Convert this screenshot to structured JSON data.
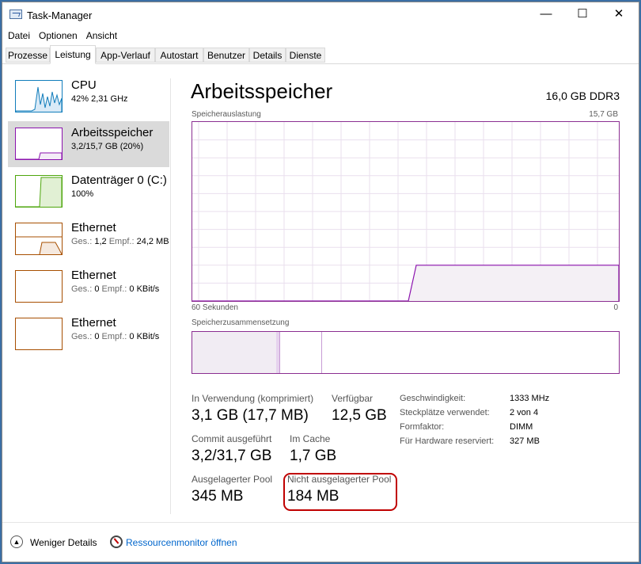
{
  "window": {
    "title": "Task-Manager",
    "minimize_glyph": "—",
    "maximize_glyph": "☐",
    "close_glyph": "✕"
  },
  "menu": {
    "items": [
      "Datei",
      "Optionen",
      "Ansicht"
    ]
  },
  "tabs": [
    "Prozesse",
    "Leistung",
    "App-Verlauf",
    "Autostart",
    "Benutzer",
    "Details",
    "Dienste"
  ],
  "active_tab": "Leistung",
  "sidebar": {
    "items": [
      {
        "title": "CPU",
        "sub": "42% 2,31 GHz",
        "color": "#117dbb"
      },
      {
        "title": "Arbeitsspeicher",
        "sub": "3,2/15,7 GB (20%)",
        "color": "#8b12ae"
      },
      {
        "title": "Datenträger 0 (C:)",
        "sub": "100%",
        "color": "#4da60c"
      },
      {
        "title": "Ethernet",
        "sub_label1": "Ges.:",
        "sub_val1": "1,2",
        "sub_label2": "Empf.:",
        "sub_val2": "24,2 MB",
        "color": "#a74f01"
      },
      {
        "title": "Ethernet",
        "sub_label1": "Ges.:",
        "sub_val1": "0",
        "sub_label2": "Empf.:",
        "sub_val2": "0 KBit/s",
        "color": "#a74f01"
      },
      {
        "title": "Ethernet",
        "sub_label1": "Ges.:",
        "sub_val1": "0",
        "sub_label2": "Empf.:",
        "sub_val2": "0 KBit/s",
        "color": "#a74f01"
      }
    ]
  },
  "detail": {
    "title": "Arbeitsspeicher",
    "spec": "16,0 GB DDR3",
    "usage_label": "Speicherauslastung",
    "usage_max": "15,7 GB",
    "time_left": "60 Sekunden",
    "time_right": "0",
    "composition_label": "Speicherzusammensetzung",
    "usage_level": 0.2,
    "stats": {
      "in_use_label": "In Verwendung (komprimiert)",
      "in_use_value": "3,1 GB (17,7 MB)",
      "available_label": "Verfügbar",
      "available_value": "12,5 GB",
      "commit_label": "Commit ausgeführt",
      "commit_value": "3,2/31,7 GB",
      "cached_label": "Im Cache",
      "cached_value": "1,7 GB",
      "paged_label": "Ausgelagerter Pool",
      "paged_value": "345 MB",
      "nonpaged_label": "Nicht ausgelagerter Pool",
      "nonpaged_value": "184 MB"
    },
    "kv": [
      {
        "label": "Geschwindigkeit:",
        "value": "1333 MHz"
      },
      {
        "label": "Steckplätze verwendet:",
        "value": "2 von 4"
      },
      {
        "label": "Formfaktor:",
        "value": "DIMM"
      },
      {
        "label": "Für Hardware reserviert:",
        "value": "327 MB"
      }
    ]
  },
  "footer": {
    "fewer_details": "Weniger Details",
    "resource_monitor": "Ressourcenmonitor öffnen"
  },
  "colors": {
    "memory": "#8b12ae",
    "highlight": "#c00000",
    "link": "#0066cc"
  }
}
